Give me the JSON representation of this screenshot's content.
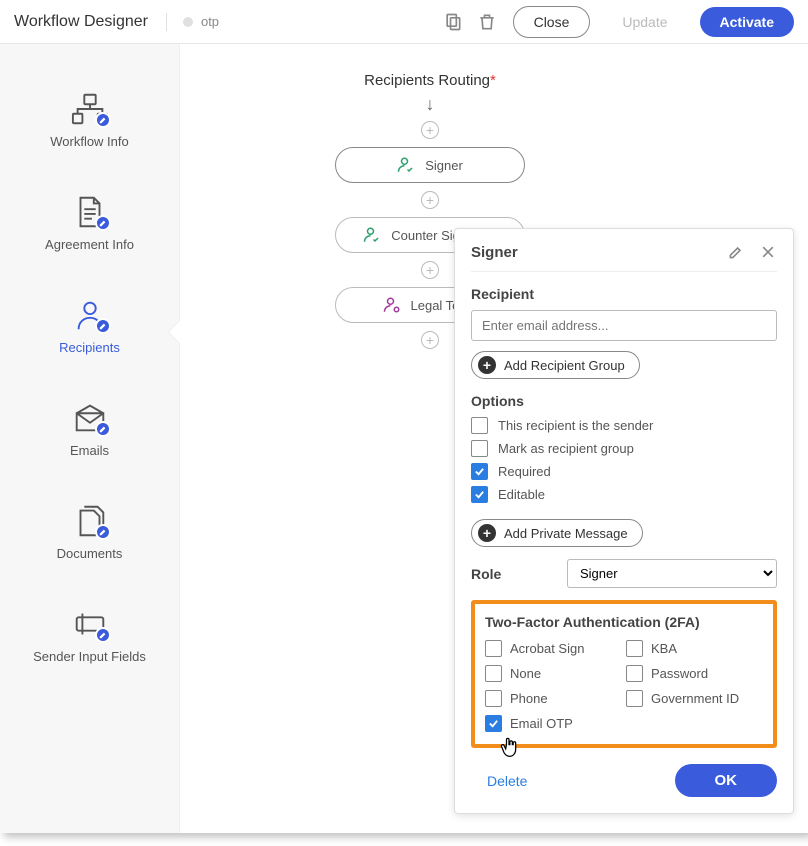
{
  "header": {
    "title": "Workflow Designer",
    "breadcrumb": "otp",
    "close": "Close",
    "update": "Update",
    "activate": "Activate"
  },
  "sidebar": {
    "items": [
      {
        "label": "Workflow Info"
      },
      {
        "label": "Agreement Info"
      },
      {
        "label": "Recipients"
      },
      {
        "label": "Emails"
      },
      {
        "label": "Documents"
      },
      {
        "label": "Sender Input Fields"
      }
    ]
  },
  "canvas": {
    "title": "Recipients Routing",
    "nodes": [
      {
        "label": "Signer"
      },
      {
        "label": "Counter Signature"
      },
      {
        "label": "Legal Team"
      }
    ]
  },
  "panel": {
    "title": "Signer",
    "recipient_label": "Recipient",
    "email_placeholder": "Enter email address...",
    "add_group": "Add Recipient Group",
    "options_label": "Options",
    "options": {
      "sender": {
        "label": "This recipient is the sender",
        "checked": false
      },
      "group": {
        "label": "Mark as recipient group",
        "checked": false
      },
      "required": {
        "label": "Required",
        "checked": true
      },
      "editable": {
        "label": "Editable",
        "checked": true
      }
    },
    "add_private": "Add Private Message",
    "role_label": "Role",
    "role_value": "Signer",
    "tfa": {
      "title": "Two-Factor Authentication (2FA)",
      "items": [
        {
          "label": "Acrobat Sign",
          "checked": false
        },
        {
          "label": "KBA",
          "checked": false
        },
        {
          "label": "None",
          "checked": false
        },
        {
          "label": "Password",
          "checked": false
        },
        {
          "label": "Phone",
          "checked": false
        },
        {
          "label": "Government ID",
          "checked": false
        },
        {
          "label": "Email OTP",
          "checked": true
        }
      ]
    },
    "delete": "Delete",
    "ok": "OK"
  }
}
